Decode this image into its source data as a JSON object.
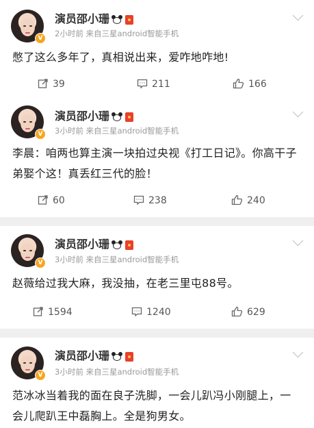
{
  "posts": [
    {
      "author": "演员邵小珊",
      "meta": "2小时前  来自三星android智能手机",
      "content": "憋了这么多年了，真相说出来，爱咋地咋地!",
      "reposts": "39",
      "comments": "211",
      "likes": "166"
    },
    {
      "author": "演员邵小珊",
      "meta": "3小时前  来自三星android智能手机",
      "content": "李晨：咱两也算主演一块拍过央视《打工日记》。你高干子弟娶个这！真丢红三代的脸！",
      "reposts": "60",
      "comments": "238",
      "likes": "240"
    },
    {
      "author": "演员邵小珊",
      "meta": "3小时前  来自三星android智能手机",
      "content": "赵薇给过我大麻，我没抽，在老三里屯88号。",
      "reposts": "1594",
      "comments": "1240",
      "likes": "629"
    },
    {
      "author": "演员邵小珊",
      "meta": "3小时前  来自三星android智能手机",
      "content": "范冰冰当着我的面在良子洗脚，一会儿趴冯小刚腿上，一会儿爬趴王中磊胸上。全是狗男女。",
      "reposts": "",
      "comments": "",
      "likes": ""
    }
  ],
  "icons": {
    "repost": "repost-icon",
    "comment": "comment-icon",
    "like": "thumbs-up-icon",
    "badge": "verified-badge-icon",
    "emoji": "panda-emoji-icon",
    "redpack": "red-envelope-icon",
    "menu": "chevron-down-icon"
  },
  "colors": {
    "badge": "#f5a623",
    "redpack": "#e8402c",
    "meta_text": "#999999",
    "separator": "#efefef"
  }
}
